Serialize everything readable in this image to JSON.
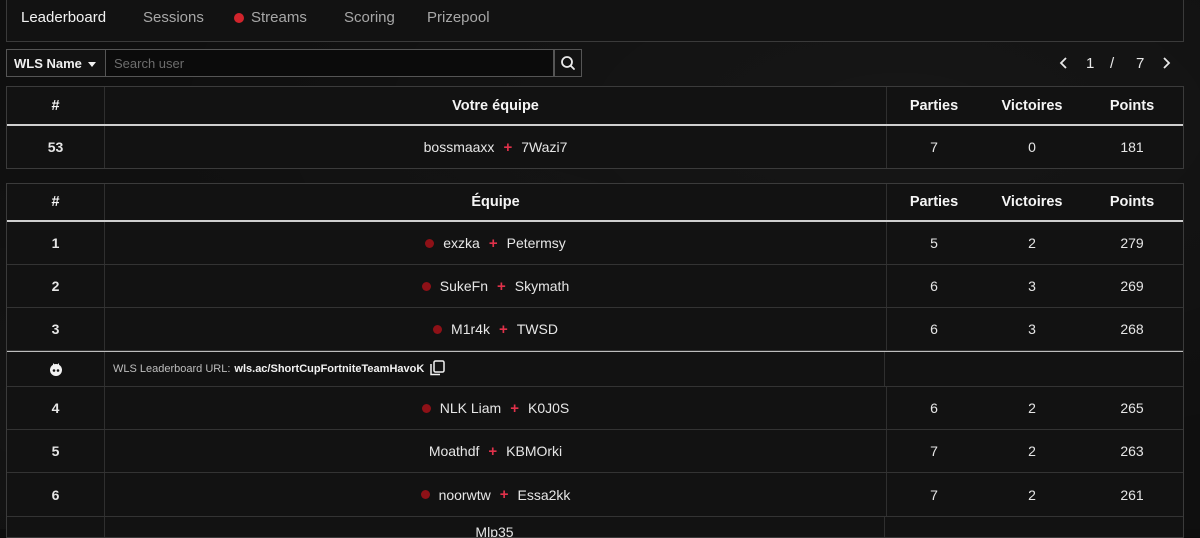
{
  "nav": {
    "tabs": [
      {
        "label": "Leaderboard",
        "active": true
      },
      {
        "label": "Sessions"
      },
      {
        "label": "Streams",
        "live": true
      },
      {
        "label": "Scoring"
      },
      {
        "label": "Prizepool"
      }
    ]
  },
  "toolbar": {
    "select_label": "WLS Name",
    "search_placeholder": "Search user",
    "search_value": ""
  },
  "pager": {
    "current": "1",
    "separator": "/",
    "total": "7"
  },
  "columns": {
    "rank": "#",
    "my_team": "Votre équipe",
    "team": "Équipe",
    "played": "Parties",
    "wins": "Victoires",
    "points": "Points"
  },
  "my_team": {
    "rank": "53",
    "player1": "bossmaaxx",
    "player2": "7Wazi7",
    "played": "7",
    "wins": "0",
    "points": "181"
  },
  "rows": [
    {
      "rank": "1",
      "player1": "exzka",
      "player2": "Petermsy",
      "played": "5",
      "wins": "2",
      "points": "279",
      "live": true
    },
    {
      "rank": "2",
      "player1": "SukeFn",
      "player2": "Skymath",
      "played": "6",
      "wins": "3",
      "points": "269",
      "live": true
    },
    {
      "rank": "3",
      "player1": "M1r4k",
      "player2": "TWSD",
      "played": "6",
      "wins": "3",
      "points": "268",
      "live": true
    },
    {
      "rank": "4",
      "player1": "NLK Liam",
      "player2": "K0J0S",
      "played": "6",
      "wins": "2",
      "points": "265",
      "live": true
    },
    {
      "rank": "5",
      "player1": "Moathdf",
      "player2": "KBMOrki",
      "played": "7",
      "wins": "2",
      "points": "263",
      "live": false
    },
    {
      "rank": "6",
      "player1": "noorwtw",
      "player2": "Essa2kk",
      "played": "7",
      "wins": "2",
      "points": "261",
      "live": true
    },
    {
      "rank": "",
      "player1": "Mlp35",
      "player2": "",
      "played": "",
      "wins": "",
      "points": "",
      "live": false
    }
  ],
  "promo": {
    "label": "WLS Leaderboard URL:",
    "url": "wls.ac/ShortCupFortniteTeamHavoK"
  },
  "colors": {
    "accent": "#e0314a",
    "live": "#d1242c",
    "background": "#0f0f0f"
  },
  "icons": [
    "search-icon",
    "chevron-left-icon",
    "chevron-right-icon",
    "wls-logo-icon",
    "copy-icon",
    "caret-down-icon"
  ]
}
